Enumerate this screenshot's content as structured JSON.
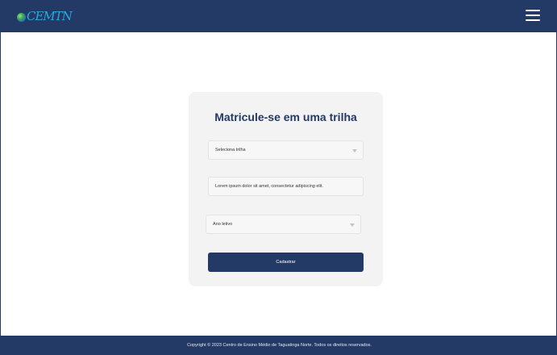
{
  "header": {
    "logo_text": "CEMTN",
    "menu_icon": "hamburger-menu-icon"
  },
  "form": {
    "title": "Matricule-se em uma trilha",
    "trilha_select": {
      "value": "Seleciona trilha"
    },
    "description_field": {
      "value": "Lorem ipsum dolor sit amet, consectetur adipiscing elit."
    },
    "ano_select": {
      "value": "Ano letivo"
    },
    "submit_label": "Cadastrar"
  },
  "footer": {
    "copyright": "Copyright © 2023 Centro de Ensino Médio de Taguatinga Norte. Todos os direitos reservados."
  },
  "colors": {
    "primary": "#243a66",
    "card_bg": "#f3f3f3",
    "logo_blue": "#29a9e0"
  }
}
